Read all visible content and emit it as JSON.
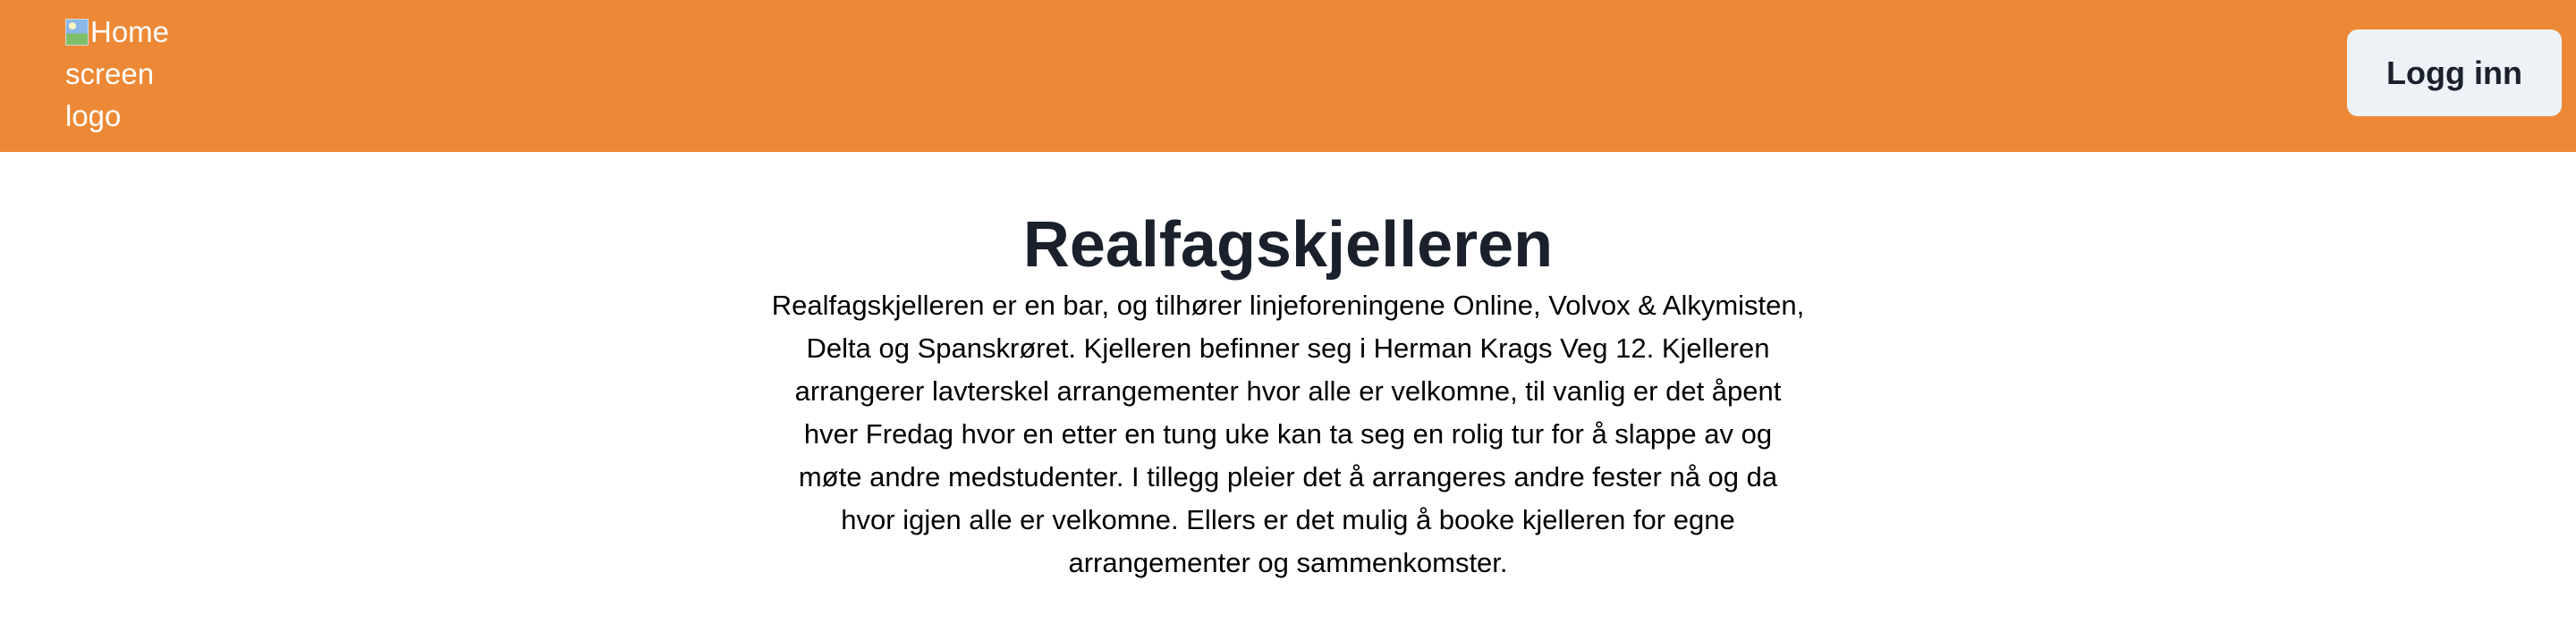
{
  "header": {
    "logo_alt": "Home screen logo",
    "login_label": "Logg inn",
    "background_color": "#ed8936"
  },
  "main": {
    "title": "Realfagskjelleren",
    "description": "Realfagskjelleren er en bar, og tilhører linjeforeningene Online, Volvox & Alkymisten, Delta og Spanskrøret. Kjelleren befinner seg i Herman Krags Veg 12. Kjelleren arrangerer lavterskel arrangementer hvor alle er velkomne, til vanlig er det åpent hver Fredag hvor en etter en tung uke kan ta seg en rolig tur for å slappe av og møte andre medstudenter. I tillegg pleier det å arrangeres andre fester nå og da hvor igjen alle er velkomne. Ellers er det mulig å booke kjelleren for egne arrangementer og sammenkomster."
  }
}
